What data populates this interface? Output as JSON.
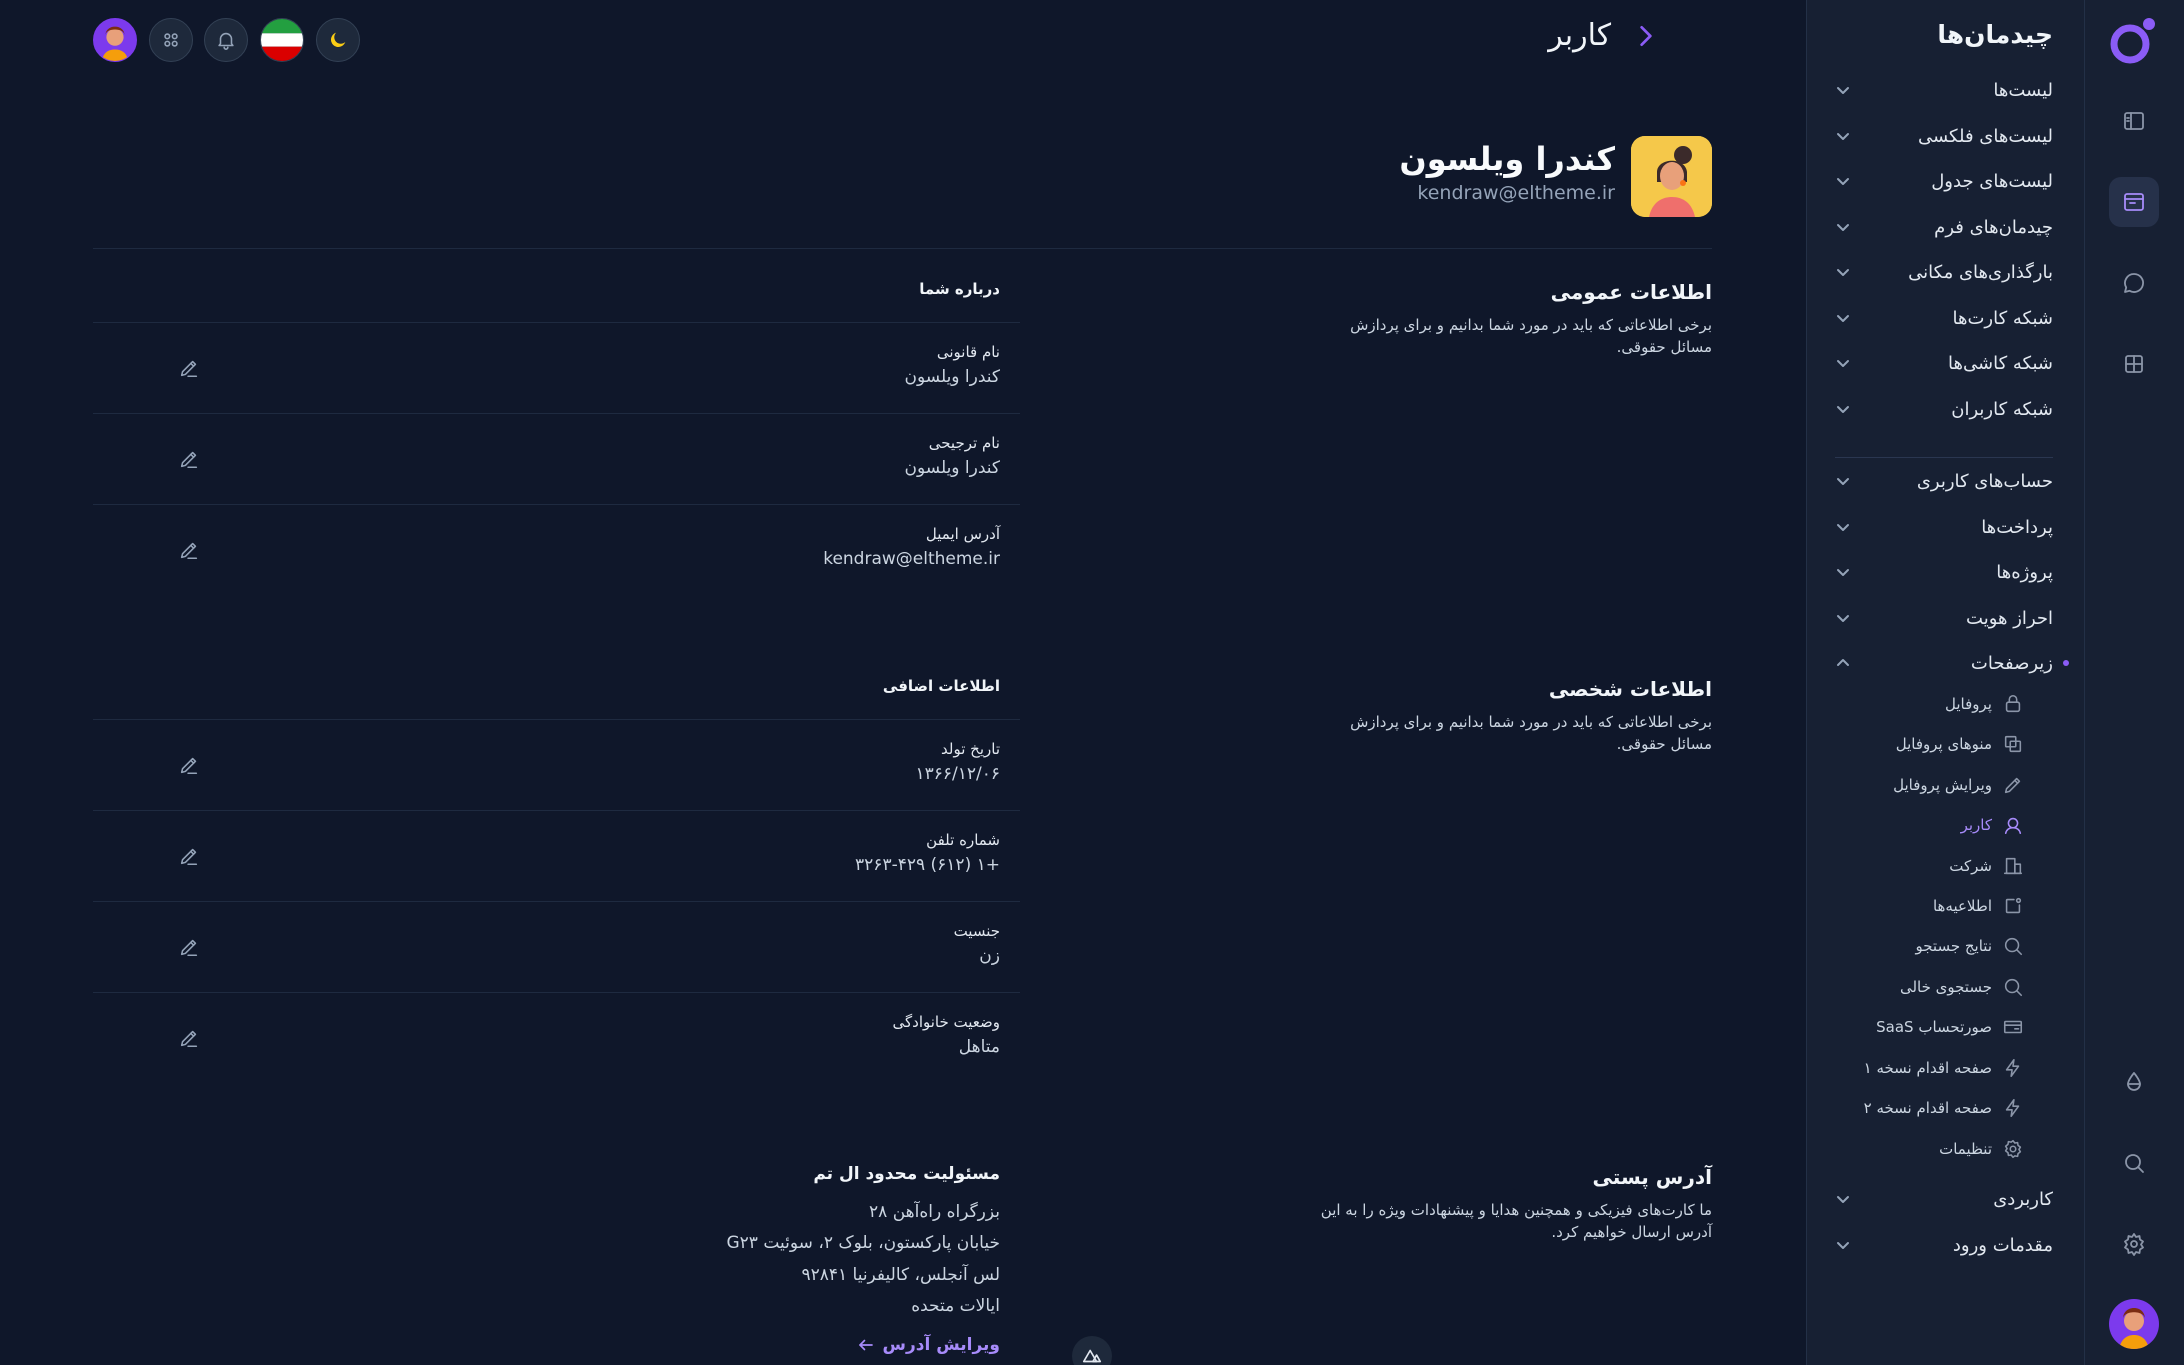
{
  "header": {
    "title": "کاربر",
    "buttons": [
      "theme-toggle",
      "language-flag",
      "notifications",
      "apps",
      "user-avatar"
    ]
  },
  "menu": {
    "title": "چیدمان‌ها",
    "groups_top": [
      "لیست‌ها",
      "لیست‌های فلکسی",
      "لیست‌های جدول",
      "چیدمان‌های فرم",
      "بارگذاری‌های مکانی",
      "شبکه کارت‌ها",
      "شبکه کاشی‌ها",
      "شبکه کاربران"
    ],
    "groups_mid": [
      "حساب‌های کاربری",
      "پرداخت‌ها",
      "پروژه‌ها",
      "احراز هویت",
      "زیرصفحات"
    ],
    "sub_items": [
      {
        "label": "پروفایل",
        "icon": "lock-icon"
      },
      {
        "label": "منوهای پروفایل",
        "icon": "copy-icon"
      },
      {
        "label": "ویرایش پروفایل",
        "icon": "pencil-icon"
      },
      {
        "label": "کاربر",
        "icon": "user-icon",
        "active": true
      },
      {
        "label": "شرکت",
        "icon": "building-icon"
      },
      {
        "label": "اطلاعیه‌ها",
        "icon": "notification-icon"
      },
      {
        "label": "نتایج جستجو",
        "icon": "search-icon"
      },
      {
        "label": "جستجوی خالی",
        "icon": "search-icon"
      },
      {
        "label": "صورتحساب SaaS",
        "icon": "credit-card-icon"
      },
      {
        "label": "صفحه اقدام نسخه ۱",
        "icon": "bolt-icon"
      },
      {
        "label": "صفحه اقدام نسخه ۲",
        "icon": "bolt-icon"
      },
      {
        "label": "تنظیمات",
        "icon": "gear-icon"
      }
    ],
    "groups_bottom": [
      "کاربردی",
      "مقدمات ورود"
    ]
  },
  "profile": {
    "name": "کندرا ویلسون",
    "email": "kendraw@eltheme.ir"
  },
  "sections": {
    "general": {
      "title": "اطلاعات عمومی",
      "description": "برخی اطلاعاتی که باید در مورد شما بدانیم و برای پردازش مسائل حقوقی."
    },
    "personal": {
      "title": "اطلاعات شخصی",
      "description": "برخی اطلاعاتی که باید در مورد شما بدانیم و برای پردازش مسائل حقوقی."
    },
    "postal": {
      "title": "آدرس پستی",
      "description": "ما کارت‌های فیزیکی و همچنین هدایا و پیشنهادات ویژه را به این آدرس ارسال خواهیم کرد."
    }
  },
  "about_card": {
    "heading": "درباره شما",
    "fields": [
      {
        "label": "نام قانونی",
        "value": "کندرا ویلسون"
      },
      {
        "label": "نام ترجیحی",
        "value": "کندرا ویلسون"
      },
      {
        "label": "آدرس ایمیل",
        "value": "kendraw@eltheme.ir"
      }
    ]
  },
  "extra_card": {
    "heading": "اطلاعات اضافی",
    "fields": [
      {
        "label": "تاریخ تولد",
        "value": "۱۳۶۶/۱۲/۰۶"
      },
      {
        "label": "شماره تلفن",
        "value": "+۱ (۶۱۲) ۳۲۶۳-۴۲۹"
      },
      {
        "label": "جنسیت",
        "value": "زن"
      },
      {
        "label": "وضعیت خانوادگی",
        "value": "متاهل"
      }
    ]
  },
  "address_card": {
    "company": "مسئولیت محدود ال تم",
    "lines": [
      "بزرگراه راه‌آهن ۲۸",
      "خیابان پارکستون، بلوک ۲، سوئیت G۲۳",
      "لس آنجلس، کالیفرنیا ۹۲۸۴۱",
      "ایالات متحده"
    ],
    "edit_label": "ویرایش آدرس"
  },
  "colors": {
    "background": "#0f172a",
    "sidebar": "#172033",
    "accent": "#8b5cf6"
  }
}
